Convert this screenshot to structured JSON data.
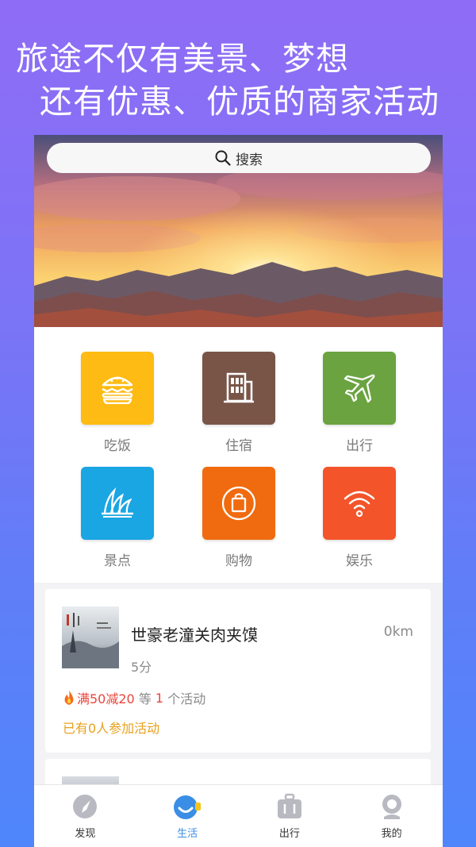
{
  "promo": {
    "line1": "旅途不仅有美景、梦想",
    "line2": "还有优惠、优质的商家活动"
  },
  "search": {
    "label": "搜索",
    "icon": "search-icon"
  },
  "categories": [
    {
      "label": "吃饭",
      "icon": "burger-icon",
      "color": "#fdbb13"
    },
    {
      "label": "住宿",
      "icon": "building-icon",
      "color": "#795548"
    },
    {
      "label": "出行",
      "icon": "airplane-icon",
      "color": "#6aa340"
    },
    {
      "label": "景点",
      "icon": "opera-house-icon",
      "color": "#1aa5e3"
    },
    {
      "label": "购物",
      "icon": "shopping-bag-icon",
      "color": "#f06b0f"
    },
    {
      "label": "娱乐",
      "icon": "wifi-icon",
      "color": "#f3542a"
    }
  ],
  "shop": {
    "name": "世豪老潼关肉夹馍",
    "distance": "0km",
    "score": "5分",
    "promo_prefix": "满50减20",
    "promo_mid": " 等 ",
    "promo_count": "1",
    "promo_suffix": " 个活动",
    "joined": "已有0人参加活动",
    "icon": "fire-icon"
  },
  "tabbar": {
    "items": [
      {
        "label": "发现",
        "icon": "compass-icon"
      },
      {
        "label": "生活",
        "icon": "life-icon"
      },
      {
        "label": "出行",
        "icon": "luggage-icon"
      },
      {
        "label": "我的",
        "icon": "profile-icon"
      }
    ],
    "active_index": 1
  },
  "colors": {
    "accent": "#3a8ee6",
    "promo_red": "#e8453c",
    "joined_orange": "#e7a11e"
  }
}
